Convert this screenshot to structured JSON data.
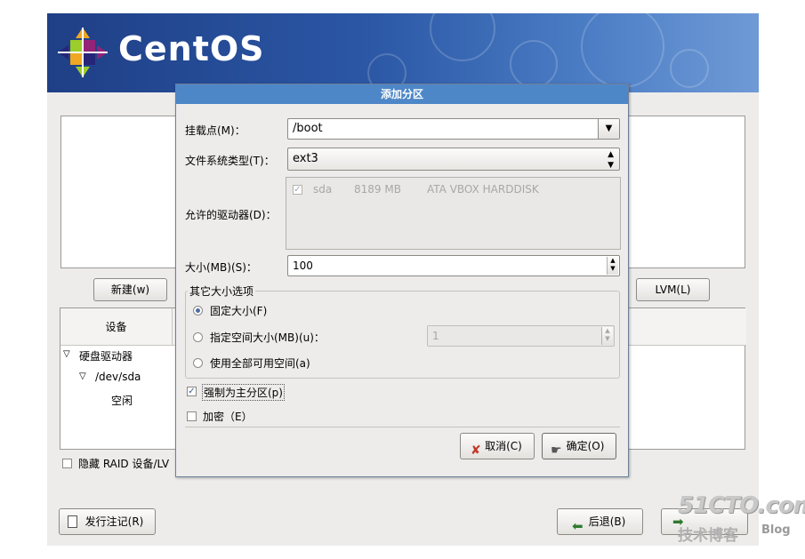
{
  "banner": {
    "logo_text": "CentOS"
  },
  "background": {
    "new_button": "新建(w)",
    "lvm_button": "LVM(L)",
    "device_column": "设备",
    "tree": {
      "hard_drives": "硬盘驱动器",
      "dev": "/dev/sda",
      "free": "空闲"
    },
    "hide_raid_label": "隐藏 RAID 设备/LV",
    "release_notes_button": "发行注记(R)",
    "back_button": "后退(B)"
  },
  "dialog": {
    "title": "添加分区",
    "mount_point_label": "挂载点(M)：",
    "mount_point_value": "/boot",
    "fs_type_label": "文件系统类型(T)：",
    "fs_type_value": "ext3",
    "drives_label": "允许的驱动器(D)：",
    "drive": {
      "name": "sda",
      "size": "8189 MB",
      "model": "ATA VBOX HARDDISK"
    },
    "size_label": "大小(MB)(S)：",
    "size_value": "100",
    "other_options_legend": "其它大小选项",
    "opt_fixed": "固定大小(F)",
    "opt_fill_to": "指定空间大小(MB)(u)：",
    "fill_to_value": "1",
    "opt_fill_all": "使用全部可用空间(a)",
    "force_primary": "强制为主分区(p)",
    "encrypt": "加密（E）",
    "cancel_button": "取消(C)",
    "ok_button": "确定(O)"
  },
  "watermark": {
    "site": "51CTO.com",
    "sub": "技术博客",
    "blog": "Blog"
  },
  "colors": {
    "title_bar": "#4d87c7",
    "banner": "#2b57a5"
  }
}
